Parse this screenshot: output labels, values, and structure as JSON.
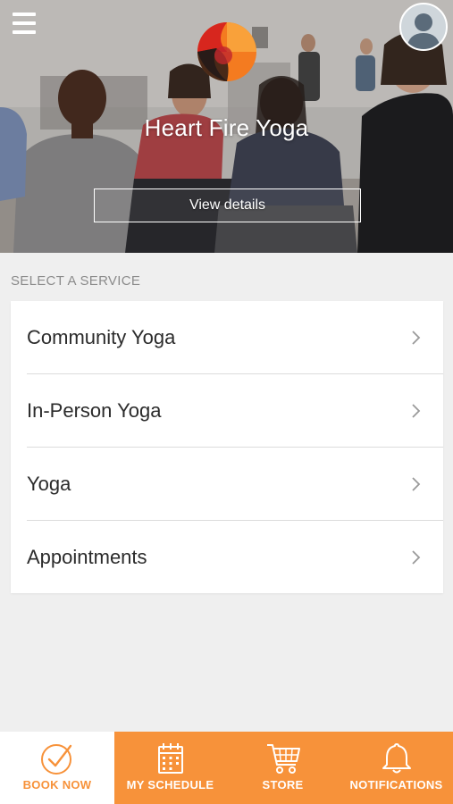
{
  "header": {
    "menu_icon": "hamburger-menu-icon",
    "avatar_icon": "user-avatar-icon",
    "studio_name": "Heart Fire Yoga",
    "view_details_label": "View details"
  },
  "services": {
    "section_label": "SELECT A SERVICE",
    "items": [
      {
        "label": "Community Yoga"
      },
      {
        "label": "In-Person Yoga"
      },
      {
        "label": "Yoga"
      },
      {
        "label": "Appointments"
      }
    ]
  },
  "tabbar": {
    "tabs": [
      {
        "label": "BOOK NOW",
        "icon": "check-circle-icon",
        "active": true
      },
      {
        "label": "MY SCHEDULE",
        "icon": "calendar-icon",
        "active": false
      },
      {
        "label": "STORE",
        "icon": "cart-icon",
        "active": false
      },
      {
        "label": "NOTIFICATIONS",
        "icon": "bell-icon",
        "active": false
      }
    ]
  },
  "colors": {
    "accent": "#f7923a",
    "background": "#efefef",
    "card": "#ffffff",
    "section_label": "#8b8b8b"
  }
}
